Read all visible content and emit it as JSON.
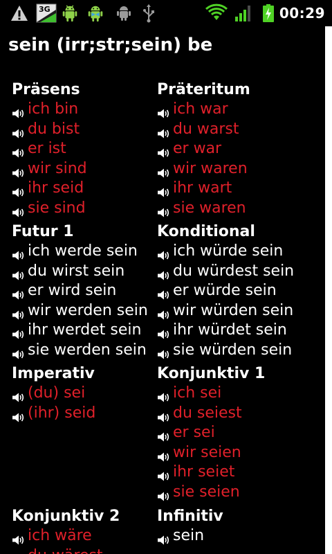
{
  "status_bar": {
    "time": "00:29",
    "network_label": "3G"
  },
  "page": {
    "title": "sein (irr;str;sein) be"
  },
  "tenses": [
    {
      "title": "Präsens",
      "color": "#e0202a",
      "forms": [
        "ich bin",
        "du bist",
        "er ist",
        "wir sind",
        "ihr seid",
        "sie sind"
      ]
    },
    {
      "title": "Präteritum",
      "color": "#e0202a",
      "forms": [
        "ich war",
        "du warst",
        "er war",
        "wir waren",
        "ihr wart",
        "sie waren"
      ]
    },
    {
      "title": "Futur 1",
      "color": "#ffffff",
      "forms": [
        "ich werde sein",
        "du wirst sein",
        "er wird sein",
        "wir werden sein",
        "ihr werdet sein",
        "sie werden sein"
      ]
    },
    {
      "title": "Konditional",
      "color": "#ffffff",
      "forms": [
        "ich würde sein",
        "du würdest sein",
        "er würde sein",
        "wir würden sein",
        "ihr würdet sein",
        "sie würden sein"
      ]
    },
    {
      "title": "Imperativ",
      "color": "#e0202a",
      "forms": [
        "(du) sei",
        "(ihr) seid"
      ]
    },
    {
      "title": "Konjunktiv 1",
      "color": "#e0202a",
      "forms": [
        "ich sei",
        "du seiest",
        "er sei",
        "wir seien",
        "ihr seiet",
        "sie seien"
      ]
    },
    {
      "title": "Konjunktiv 2",
      "color": "#e0202a",
      "forms": [
        "ich wäre",
        "du wärest"
      ]
    },
    {
      "title": "Infinitiv",
      "color": "#ffffff",
      "forms": [
        "sein"
      ]
    }
  ]
}
